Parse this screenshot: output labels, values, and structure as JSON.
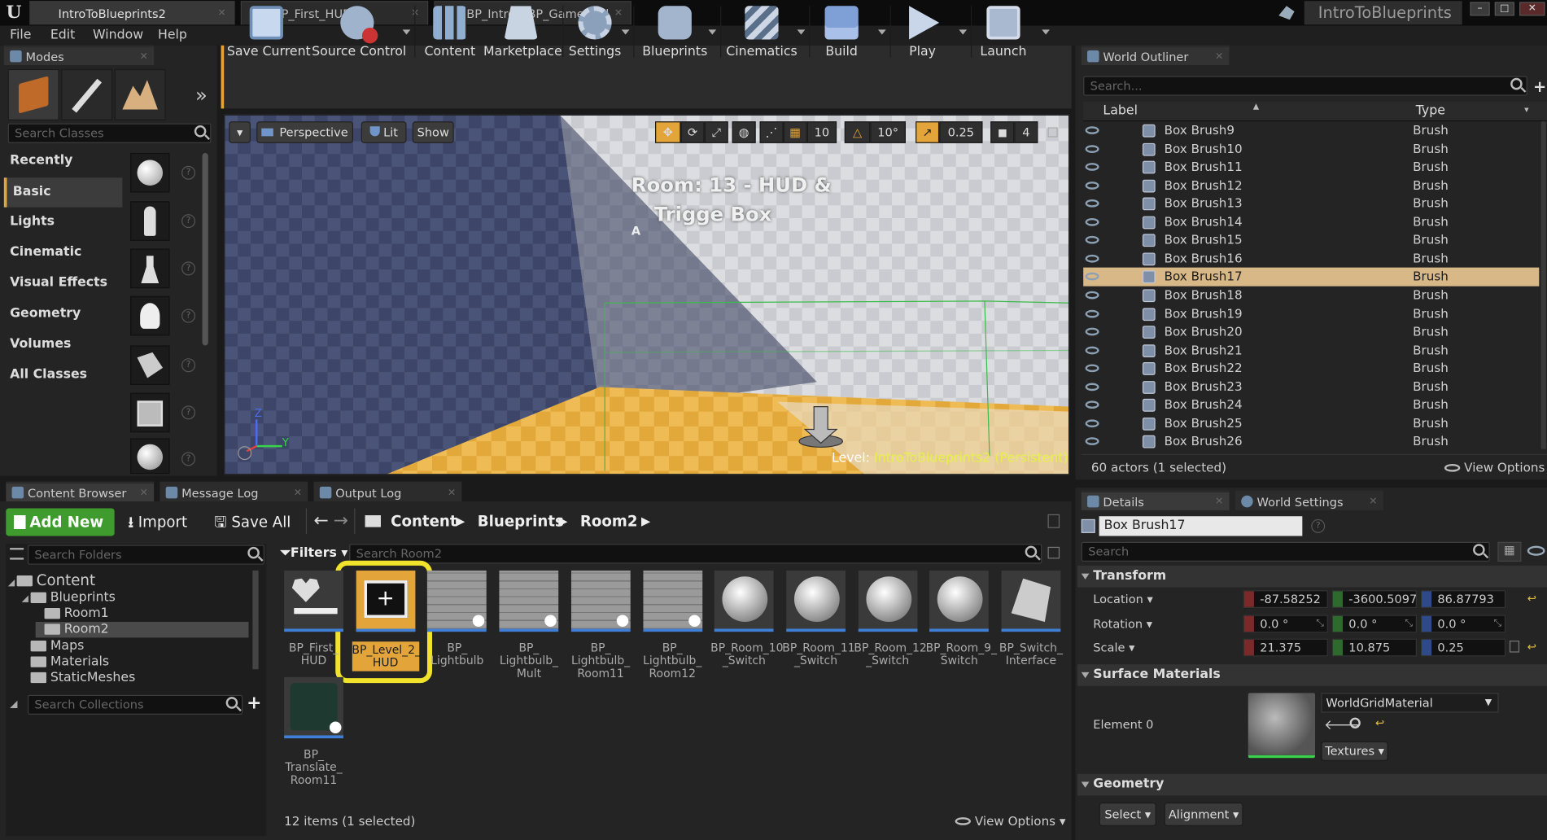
{
  "titlebar": {
    "tabs": [
      {
        "label": "IntroToBlueprints2"
      },
      {
        "label": "BP_First_HUD*"
      },
      {
        "label": "BP_IntroToBP_GameMod"
      }
    ],
    "project_name": "IntroToBlueprints"
  },
  "menu": {
    "items": [
      "File",
      "Edit",
      "Window",
      "Help"
    ]
  },
  "modes": {
    "tab_label": "Modes",
    "search_placeholder": "Search Classes",
    "categories": [
      "Recently Placed",
      "Basic",
      "Lights",
      "Cinematic",
      "Visual Effects",
      "Geometry",
      "Volumes",
      "All Classes"
    ],
    "selected_category": "Basic"
  },
  "toolbar": {
    "buttons": [
      "Save Current",
      "Source Control",
      "Content",
      "Marketplace",
      "Settings",
      "Blueprints",
      "Cinematics",
      "Build",
      "Play",
      "Launch"
    ]
  },
  "viewport": {
    "perspective": "Perspective",
    "lit": "Lit",
    "show": "Show",
    "grid_snap": "10",
    "rot_snap": "10°",
    "scale_snap": "0.25",
    "camera_speed": "4",
    "room_text_line1": "Room: 13 - HUD &",
    "room_text_line2": "Trigge Box",
    "marker": "A",
    "level_label": "Level:",
    "level_name": "IntroToBlueprints2 (Persistent)",
    "axis_z": "Z",
    "axis_y": "Y"
  },
  "outliner": {
    "tab_label": "World Outliner",
    "search_placeholder": "Search...",
    "col_label": "Label",
    "col_type": "Type",
    "rows": [
      {
        "label": "Box Brush9",
        "type": "Brush"
      },
      {
        "label": "Box Brush10",
        "type": "Brush"
      },
      {
        "label": "Box Brush11",
        "type": "Brush"
      },
      {
        "label": "Box Brush12",
        "type": "Brush"
      },
      {
        "label": "Box Brush13",
        "type": "Brush"
      },
      {
        "label": "Box Brush14",
        "type": "Brush"
      },
      {
        "label": "Box Brush15",
        "type": "Brush"
      },
      {
        "label": "Box Brush16",
        "type": "Brush"
      },
      {
        "label": "Box Brush17",
        "type": "Brush"
      },
      {
        "label": "Box Brush18",
        "type": "Brush"
      },
      {
        "label": "Box Brush19",
        "type": "Brush"
      },
      {
        "label": "Box Brush20",
        "type": "Brush"
      },
      {
        "label": "Box Brush21",
        "type": "Brush"
      },
      {
        "label": "Box Brush22",
        "type": "Brush"
      },
      {
        "label": "Box Brush23",
        "type": "Brush"
      },
      {
        "label": "Box Brush24",
        "type": "Brush"
      },
      {
        "label": "Box Brush25",
        "type": "Brush"
      },
      {
        "label": "Box Brush26",
        "type": "Brush"
      }
    ],
    "selected_index": 8,
    "footer_count": "60 actors (1 selected)",
    "view_options": "View Options"
  },
  "details": {
    "tab_label": "Details",
    "world_settings_tab": "World Settings",
    "object_name": "Box Brush17",
    "search_placeholder": "Search",
    "transform_header": "Transform",
    "location_label": "Location",
    "rotation_label": "Rotation",
    "scale_label": "Scale",
    "location": [
      "-87.58252",
      "-3600.5097",
      "86.87793"
    ],
    "rotation": [
      "0.0 °",
      "0.0 °",
      "0.0 °"
    ],
    "scale": [
      "21.375",
      "10.875",
      "0.25"
    ],
    "surface_materials_header": "Surface Materials",
    "element_label": "Element 0",
    "material_name": "WorldGridMaterial",
    "textures_btn": "Textures",
    "geometry_header": "Geometry",
    "select_btn": "Select",
    "alignment_btn": "Alignment"
  },
  "bottom_tabs": {
    "content_browser": "Content Browser",
    "message_log": "Message Log",
    "output_log": "Output Log"
  },
  "content_browser": {
    "add_new": "Add New",
    "import": "Import",
    "save_all": "Save All",
    "crumbs": [
      "Content",
      "Blueprints",
      "Room2"
    ],
    "folder_search_placeholder": "Search Folders",
    "filters": "Filters",
    "asset_search_placeholder": "Search Room2",
    "collections_placeholder": "Search Collections",
    "tree": [
      {
        "label": "Content",
        "depth": 0
      },
      {
        "label": "Blueprints",
        "depth": 1
      },
      {
        "label": "Room1",
        "depth": 2
      },
      {
        "label": "Room2",
        "depth": 2
      },
      {
        "label": "Maps",
        "depth": 1
      },
      {
        "label": "Materials",
        "depth": 1
      },
      {
        "label": "StaticMeshes",
        "depth": 1
      }
    ],
    "assets": [
      {
        "name": "BP_First_ HUD"
      },
      {
        "name": "BP_Level_2_ HUD"
      },
      {
        "name": "BP_ Lightbulb"
      },
      {
        "name": "BP_ Lightbulb_ Mult"
      },
      {
        "name": "BP_ Lightbulb_ Room11"
      },
      {
        "name": "BP_ Lightbulb_ Room12"
      },
      {
        "name": "BP_Room_10 _Switch"
      },
      {
        "name": "BP_Room_11 _Switch"
      },
      {
        "name": "BP_Room_12 _Switch"
      },
      {
        "name": "BP_Room_9_ Switch"
      },
      {
        "name": "BP_Switch_ Interface"
      },
      {
        "name": "BP_ Translate_ Room11"
      }
    ],
    "footer_count": "12 items (1 selected)",
    "view_options": "View Options"
  },
  "colors": {
    "accent": "#e3a53a",
    "selected_row": "#d9b887",
    "highlight_ring": "#f1e22b",
    "add_new_green": "#3f9b2e"
  }
}
